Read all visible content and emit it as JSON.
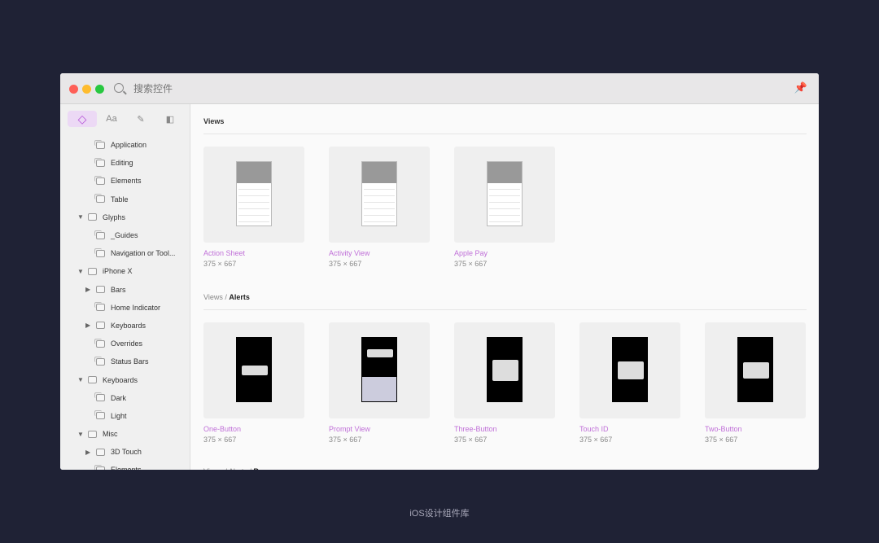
{
  "window": {
    "search_placeholder": "搜索控件"
  },
  "colors": {
    "accent": "#c070d8",
    "close": "#fe5f57",
    "minimize": "#febc2e",
    "zoom": "#28c840",
    "background": "#1f2235"
  },
  "sidebar": {
    "tabs": [
      {
        "icon": "symbol-diamond-icon",
        "label": "",
        "active": true
      },
      {
        "icon": "text-styles-icon",
        "label": "Aa"
      },
      {
        "icon": "pen-icon",
        "label": "✎"
      },
      {
        "icon": "layer-styles-icon",
        "label": "◧"
      }
    ],
    "items": [
      {
        "label": "Application",
        "level": 2,
        "type": "symbol"
      },
      {
        "label": "Editing",
        "level": 2,
        "type": "symbol"
      },
      {
        "label": "Elements",
        "level": 2,
        "type": "symbol"
      },
      {
        "label": "Table",
        "level": 2,
        "type": "symbol"
      },
      {
        "label": "Glyphs",
        "level": 1,
        "type": "folder",
        "expanded": true
      },
      {
        "label": "_Guides",
        "level": 2,
        "type": "symbol"
      },
      {
        "label": "Navigation or Tool...",
        "level": 2,
        "type": "symbol"
      },
      {
        "label": "iPhone X",
        "level": 1,
        "type": "folder",
        "expanded": true
      },
      {
        "label": "Bars",
        "level": 2,
        "type": "folder",
        "expanded": false
      },
      {
        "label": "Home Indicator",
        "level": 2,
        "type": "symbol"
      },
      {
        "label": "Keyboards",
        "level": 2,
        "type": "folder",
        "expanded": false
      },
      {
        "label": "Overrides",
        "level": 2,
        "type": "symbol"
      },
      {
        "label": "Status Bars",
        "level": 2,
        "type": "symbol"
      },
      {
        "label": "Keyboards",
        "level": 1,
        "type": "folder",
        "expanded": true
      },
      {
        "label": "Dark",
        "level": 2,
        "type": "symbol"
      },
      {
        "label": "Light",
        "level": 2,
        "type": "symbol"
      },
      {
        "label": "Misc",
        "level": 1,
        "type": "folder",
        "expanded": true
      },
      {
        "label": "3D Touch",
        "level": 2,
        "type": "folder",
        "expanded": false
      },
      {
        "label": "Elements",
        "level": 2,
        "type": "symbol"
      }
    ]
  },
  "sections": [
    {
      "path": "Views",
      "current": "",
      "cards": [
        {
          "name": "Action Sheet",
          "size": "375 × 667"
        },
        {
          "name": "Activity View",
          "size": "375 × 667"
        },
        {
          "name": "Apple Pay",
          "size": "375 × 667"
        }
      ]
    },
    {
      "path": "Views / ",
      "current": "Alerts",
      "cards": [
        {
          "name": "One-Button",
          "size": "375 × 667"
        },
        {
          "name": "Prompt View",
          "size": "375 × 667"
        },
        {
          "name": "Three-Button",
          "size": "375 × 667"
        },
        {
          "name": "Touch ID",
          "size": "375 × 667"
        },
        {
          "name": "Two-Button",
          "size": "375 × 667"
        }
      ]
    },
    {
      "path": "Views / Alerts / ",
      "current": "Resources",
      "cards": []
    }
  ],
  "caption": "iOS设计组件库"
}
